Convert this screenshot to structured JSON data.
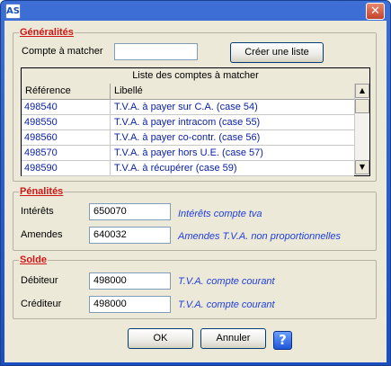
{
  "window": {
    "app_icon_glyph": "AS",
    "close_glyph": "✕"
  },
  "generalites": {
    "legend": "Généralités",
    "compte_label": "Compte à matcher",
    "compte_value": "",
    "create_list_button": "Créer une liste",
    "list_caption": "Liste des comptes à matcher",
    "columns": [
      "Référence",
      "Libellé"
    ],
    "rows": [
      {
        "ref": "498540",
        "lib": "T.V.A. à payer sur C.A. (case 54)"
      },
      {
        "ref": "498550",
        "lib": "T.V.A. à payer intracom (case 55)"
      },
      {
        "ref": "498560",
        "lib": "T.V.A. à payer co-contr. (case 56)"
      },
      {
        "ref": "498570",
        "lib": "T.V.A. à payer hors U.E. (case 57)"
      },
      {
        "ref": "498590",
        "lib": "T.V.A. à récupérer (case 59)"
      }
    ]
  },
  "penalites": {
    "legend": "Pénalités",
    "interets_label": "Intérêts",
    "interets_value": "650070",
    "interets_hint": "Intérêts compte tva",
    "amendes_label": "Amendes",
    "amendes_value": "640032",
    "amendes_hint": "Amendes T.V.A. non proportionnelles"
  },
  "solde": {
    "legend": "Solde",
    "debiteur_label": "Débiteur",
    "debiteur_value": "498000",
    "debiteur_hint": "T.V.A. compte courant",
    "crediteur_label": "Créditeur",
    "crediteur_value": "498000",
    "crediteur_hint": "T.V.A. compte courant"
  },
  "footer": {
    "ok_label": "OK",
    "cancel_label": "Annuler",
    "help_glyph": "?"
  },
  "colors": {
    "legend": "#d01515",
    "hint": "#1f3ee0",
    "title_bar": "#1b4fbf"
  },
  "icons": {
    "app": "app-icon",
    "close": "close-icon",
    "help": "help-icon",
    "scroll_up": "arrow-up-icon",
    "scroll_down": "arrow-down-icon"
  }
}
